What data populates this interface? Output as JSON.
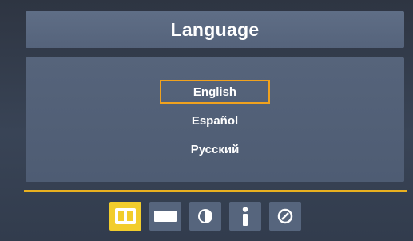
{
  "menu": {
    "title": "Language",
    "languages": [
      {
        "label": "English",
        "selected": true
      },
      {
        "label": "Español",
        "selected": false
      },
      {
        "label": "Русский",
        "selected": false
      }
    ]
  },
  "tabs": [
    {
      "icon": "language-icon",
      "active": true
    },
    {
      "icon": "picture-icon",
      "active": false
    },
    {
      "icon": "brightness-icon",
      "active": false
    },
    {
      "icon": "info-icon",
      "active": false
    },
    {
      "icon": "settings-icon",
      "active": false
    }
  ],
  "colors": {
    "accent": "#f0a21e",
    "active_tab": "#f2cd2c",
    "divider": "#e9b020",
    "panel": "#55637b"
  }
}
